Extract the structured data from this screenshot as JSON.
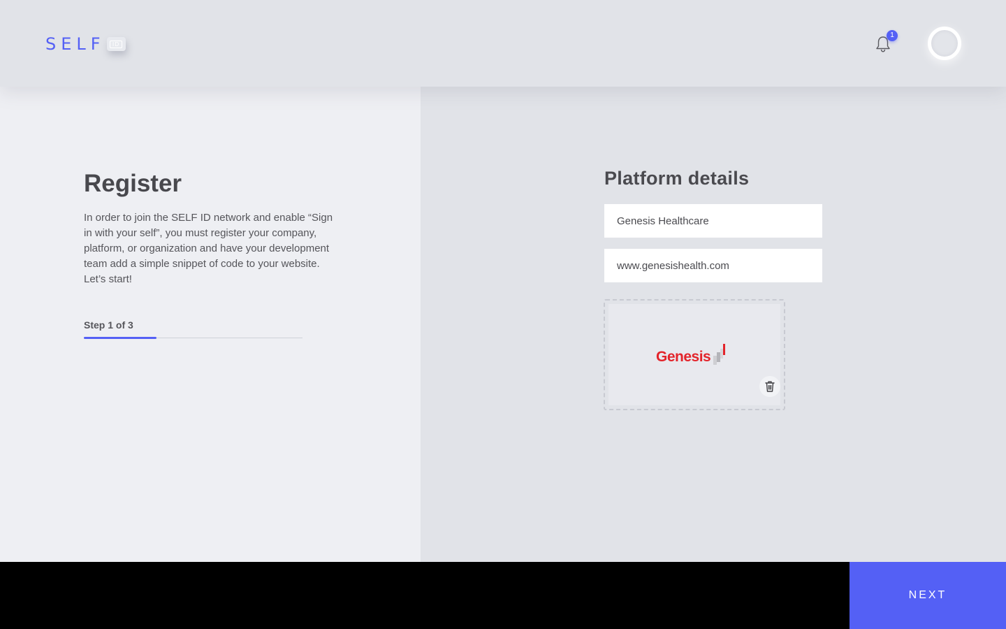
{
  "header": {
    "logo_text": "SELF",
    "logo_badge": "ID",
    "notifications_count": "1"
  },
  "register": {
    "title": "Register",
    "intro": "In order to join the SELF ID network and enable “Sign in with your self”, you must register your company, platform, or organization and have your development team add a simple snippet of code to your website.  Let’s start!",
    "step_label": "Step 1 of 3",
    "step_current": 1,
    "step_total": 3
  },
  "platform": {
    "title": "Platform details",
    "name_value": "Genesis Healthcare",
    "url_value": "www.genesishealth.com",
    "logo_text": "Genesis"
  },
  "footer": {
    "next_label": "NEXT"
  },
  "colors": {
    "accent": "#5460f5",
    "brand_red": "#e3242b",
    "footer": "#000000"
  },
  "icons": {
    "notifications": "bell-icon",
    "delete": "trash-icon",
    "profile": "avatar-ring"
  }
}
